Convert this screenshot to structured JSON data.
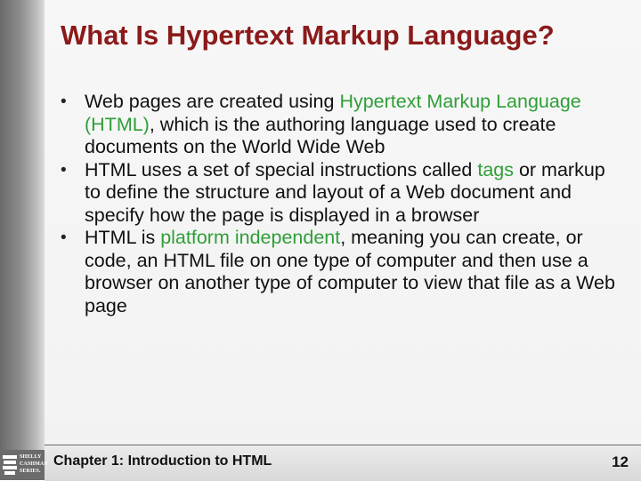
{
  "slide": {
    "title": "What Is Hypertext Markup Language?",
    "bullets": [
      {
        "parts": [
          {
            "text": "Web pages are created using ",
            "highlight": false
          },
          {
            "text": "Hypertext Markup Language (HTML)",
            "highlight": true
          },
          {
            "text": ", which is the authoring language used to create documents on the World Wide Web",
            "highlight": false
          }
        ]
      },
      {
        "parts": [
          {
            "text": "HTML uses a set of special instructions called ",
            "highlight": false
          },
          {
            "text": "tags",
            "highlight": true
          },
          {
            "text": " or markup to define the structure and layout of a Web document and specify how the page is displayed in a browser",
            "highlight": false
          }
        ]
      },
      {
        "parts": [
          {
            "text": "HTML is ",
            "highlight": false
          },
          {
            "text": "platform independent",
            "highlight": true
          },
          {
            "text": ", meaning you can create, or code, an HTML file on one type of computer and then use a browser on another type of computer to view that file as a Web page",
            "highlight": false
          }
        ]
      }
    ],
    "bullet_symbol": "•",
    "footer": "Chapter 1: Introduction to HTML",
    "page_number": "12"
  },
  "logo": {
    "lines": [
      "SHELLY",
      "CASHMAN",
      "SERIES."
    ]
  },
  "colors": {
    "title": "#8b1a1a",
    "highlight": "#2f9e37",
    "body_text": "#111111",
    "side_strip": "#8c8c8c",
    "logo_bg": "#6b6b6b"
  }
}
